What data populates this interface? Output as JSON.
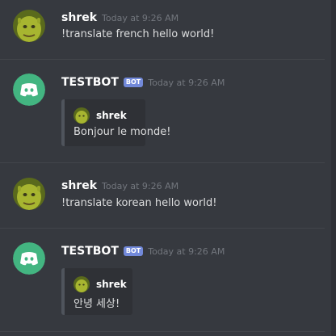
{
  "colors": {
    "background": "#36393f",
    "bot_tag": "#7289da",
    "discord_green": "#43b581",
    "shrek_green": "#a7b530"
  },
  "messages": [
    {
      "author": "shrek",
      "avatar_icon": "shrek-avatar-icon",
      "timestamp": "Today at 9:26 AM",
      "content": "!translate french hello world!"
    },
    {
      "author": "TESTBOT",
      "avatar_icon": "discord-logo-icon",
      "bot_tag": "BOT",
      "timestamp": "Today at 9:26 AM",
      "embed": {
        "author": "shrek",
        "author_icon": "shrek-avatar-icon",
        "description": "Bonjour le monde!"
      }
    },
    {
      "author": "shrek",
      "avatar_icon": "shrek-avatar-icon",
      "timestamp": "Today at 9:26 AM",
      "content": "!translate korean hello world!"
    },
    {
      "author": "TESTBOT",
      "avatar_icon": "discord-logo-icon",
      "bot_tag": "BOT",
      "timestamp": "Today at 9:26 AM",
      "embed": {
        "author": "shrek",
        "author_icon": "shrek-avatar-icon",
        "description": "안녕 세상!"
      }
    }
  ]
}
